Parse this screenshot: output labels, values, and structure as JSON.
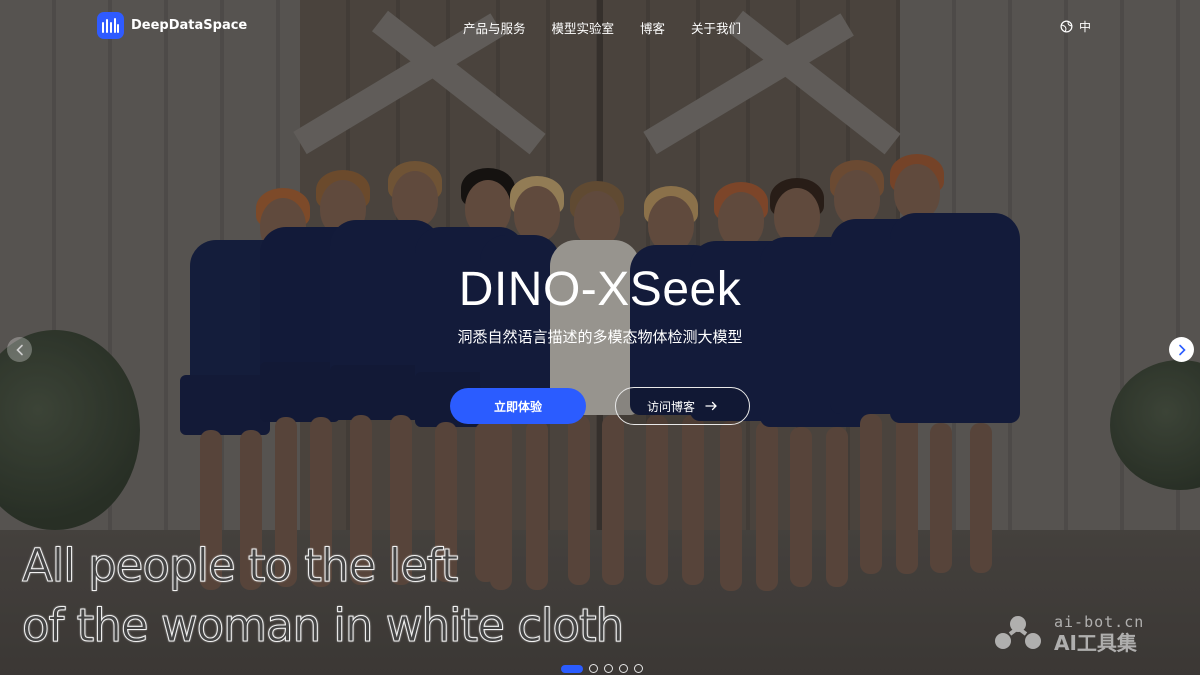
{
  "header": {
    "brand": "DeepDataSpace",
    "nav": [
      {
        "label": "产品与服务"
      },
      {
        "label": "模型实验室"
      },
      {
        "label": "博客"
      },
      {
        "label": "关于我们"
      }
    ],
    "lang_label": "中"
  },
  "hero": {
    "title": "DINO-XSeek",
    "subtitle": "洞悉自然语言描述的多模态物体检测大模型",
    "primary_button": "立即体验",
    "secondary_button": "访问博客"
  },
  "carousel": {
    "slide_count": 5,
    "active_index": 0
  },
  "caption": {
    "line1": "All people to the left",
    "line2": "of the woman in white cloth"
  },
  "watermark": {
    "url": "ai-bot.cn",
    "name": "AI工具集"
  },
  "colors": {
    "accent": "#2b5cff",
    "text": "#ffffff"
  }
}
